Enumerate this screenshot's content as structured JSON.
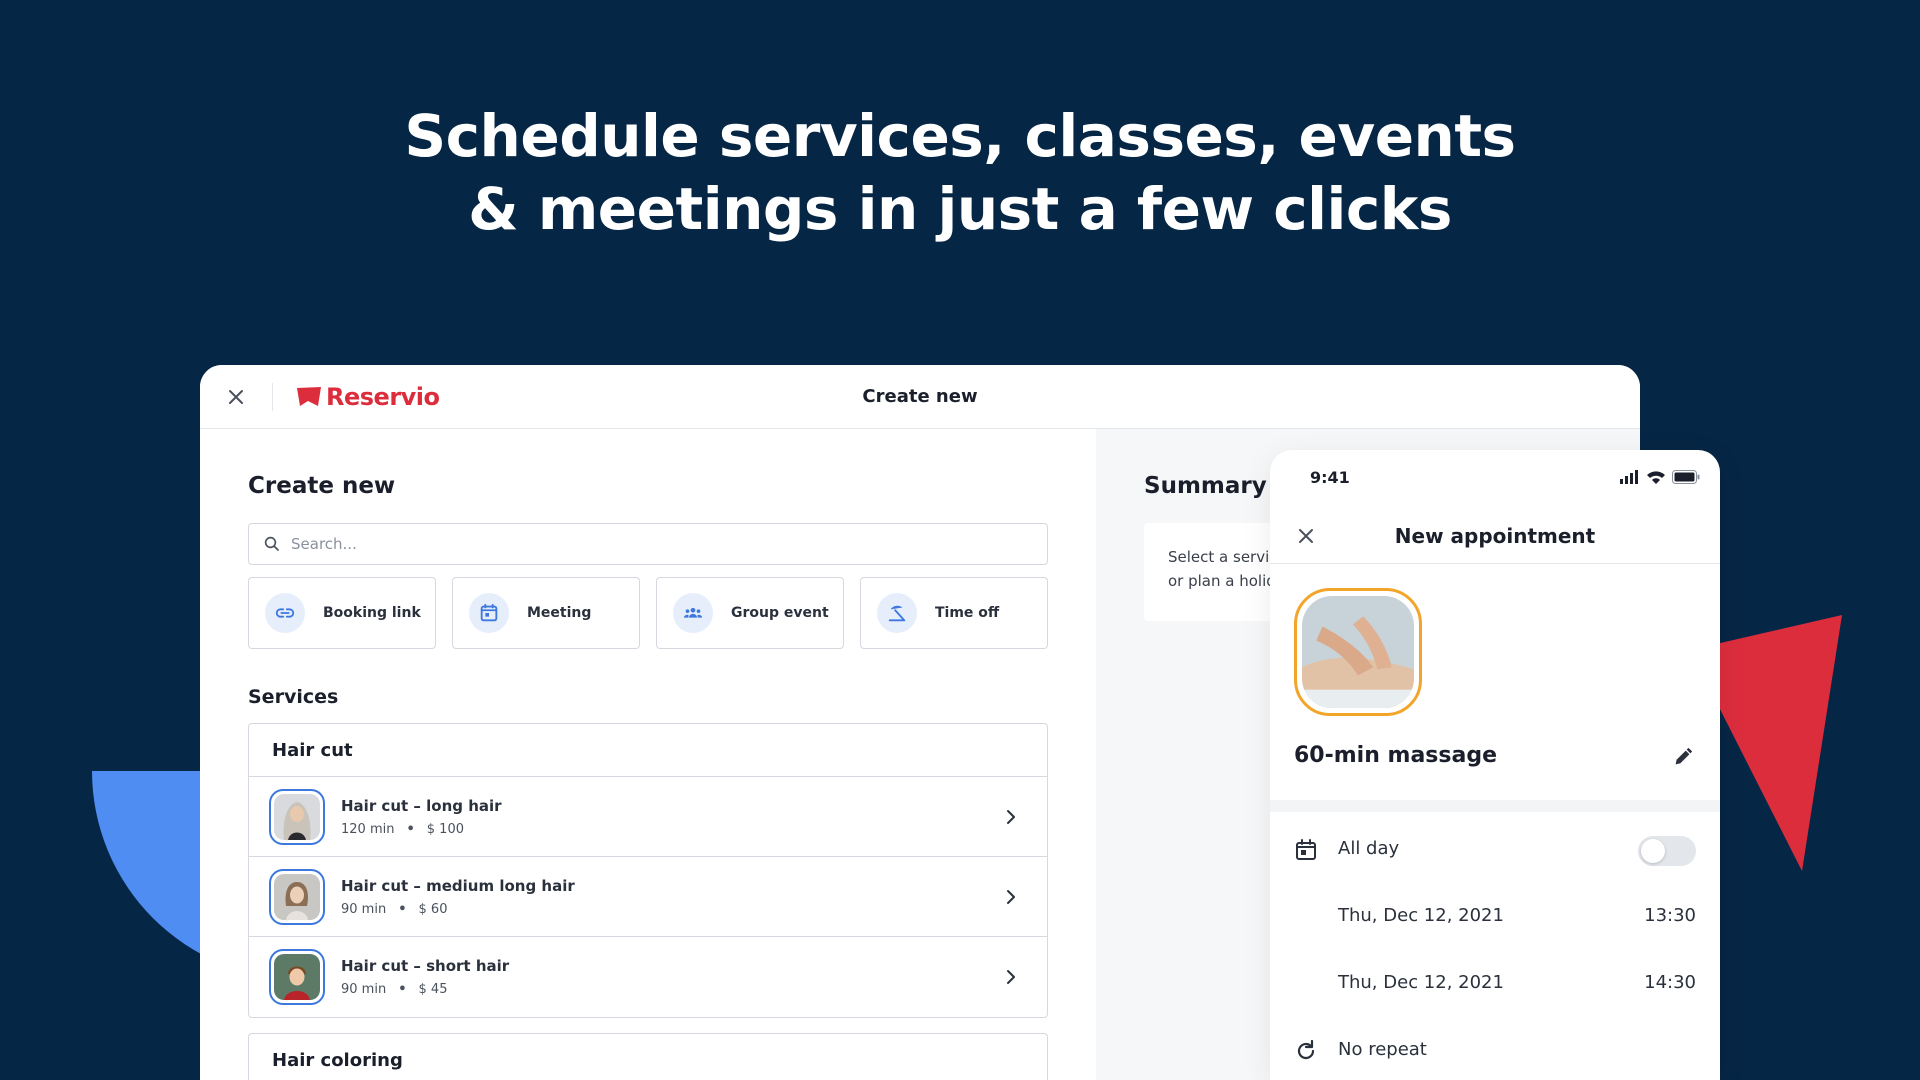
{
  "hero": {
    "line1": "Schedule services, classes, events",
    "line2": "& meetings in just a few clicks"
  },
  "window": {
    "brand": "Reservio",
    "title": "Create new"
  },
  "left": {
    "heading": "Create new",
    "search_placeholder": "Search...",
    "quick_actions": [
      {
        "label": "Booking link",
        "icon": "link-icon"
      },
      {
        "label": "Meeting",
        "icon": "calendar-icon"
      },
      {
        "label": "Group event",
        "icon": "group-icon"
      },
      {
        "label": "Time off",
        "icon": "umbrella-icon"
      }
    ],
    "services_heading": "Services",
    "groups": [
      {
        "name": "Hair cut",
        "items": [
          {
            "name": "Hair cut – long hair",
            "duration": "120 min",
            "price": "$ 100"
          },
          {
            "name": "Hair cut – medium long hair",
            "duration": "90 min",
            "price": "$ 60"
          },
          {
            "name": "Hair cut – short hair",
            "duration": "90 min",
            "price": "$ 45"
          }
        ]
      },
      {
        "name": "Hair coloring",
        "items": []
      }
    ]
  },
  "summary": {
    "heading": "Summary",
    "text": "Select a service or plan a holiday"
  },
  "phone": {
    "time": "9:41",
    "title": "New appointment",
    "service_name": "60-min massage",
    "all_day_label": "All day",
    "all_day_on": false,
    "start_date": "Thu, Dec 12, 2021",
    "start_time": "13:30",
    "end_date": "Thu, Dec 12, 2021",
    "end_time": "14:30",
    "repeat_label": "No repeat"
  },
  "colors": {
    "background": "#062645",
    "brand_red": "#dc2d3d",
    "accent_blue": "#3d78de",
    "photo_ring": "#f2a52b"
  }
}
